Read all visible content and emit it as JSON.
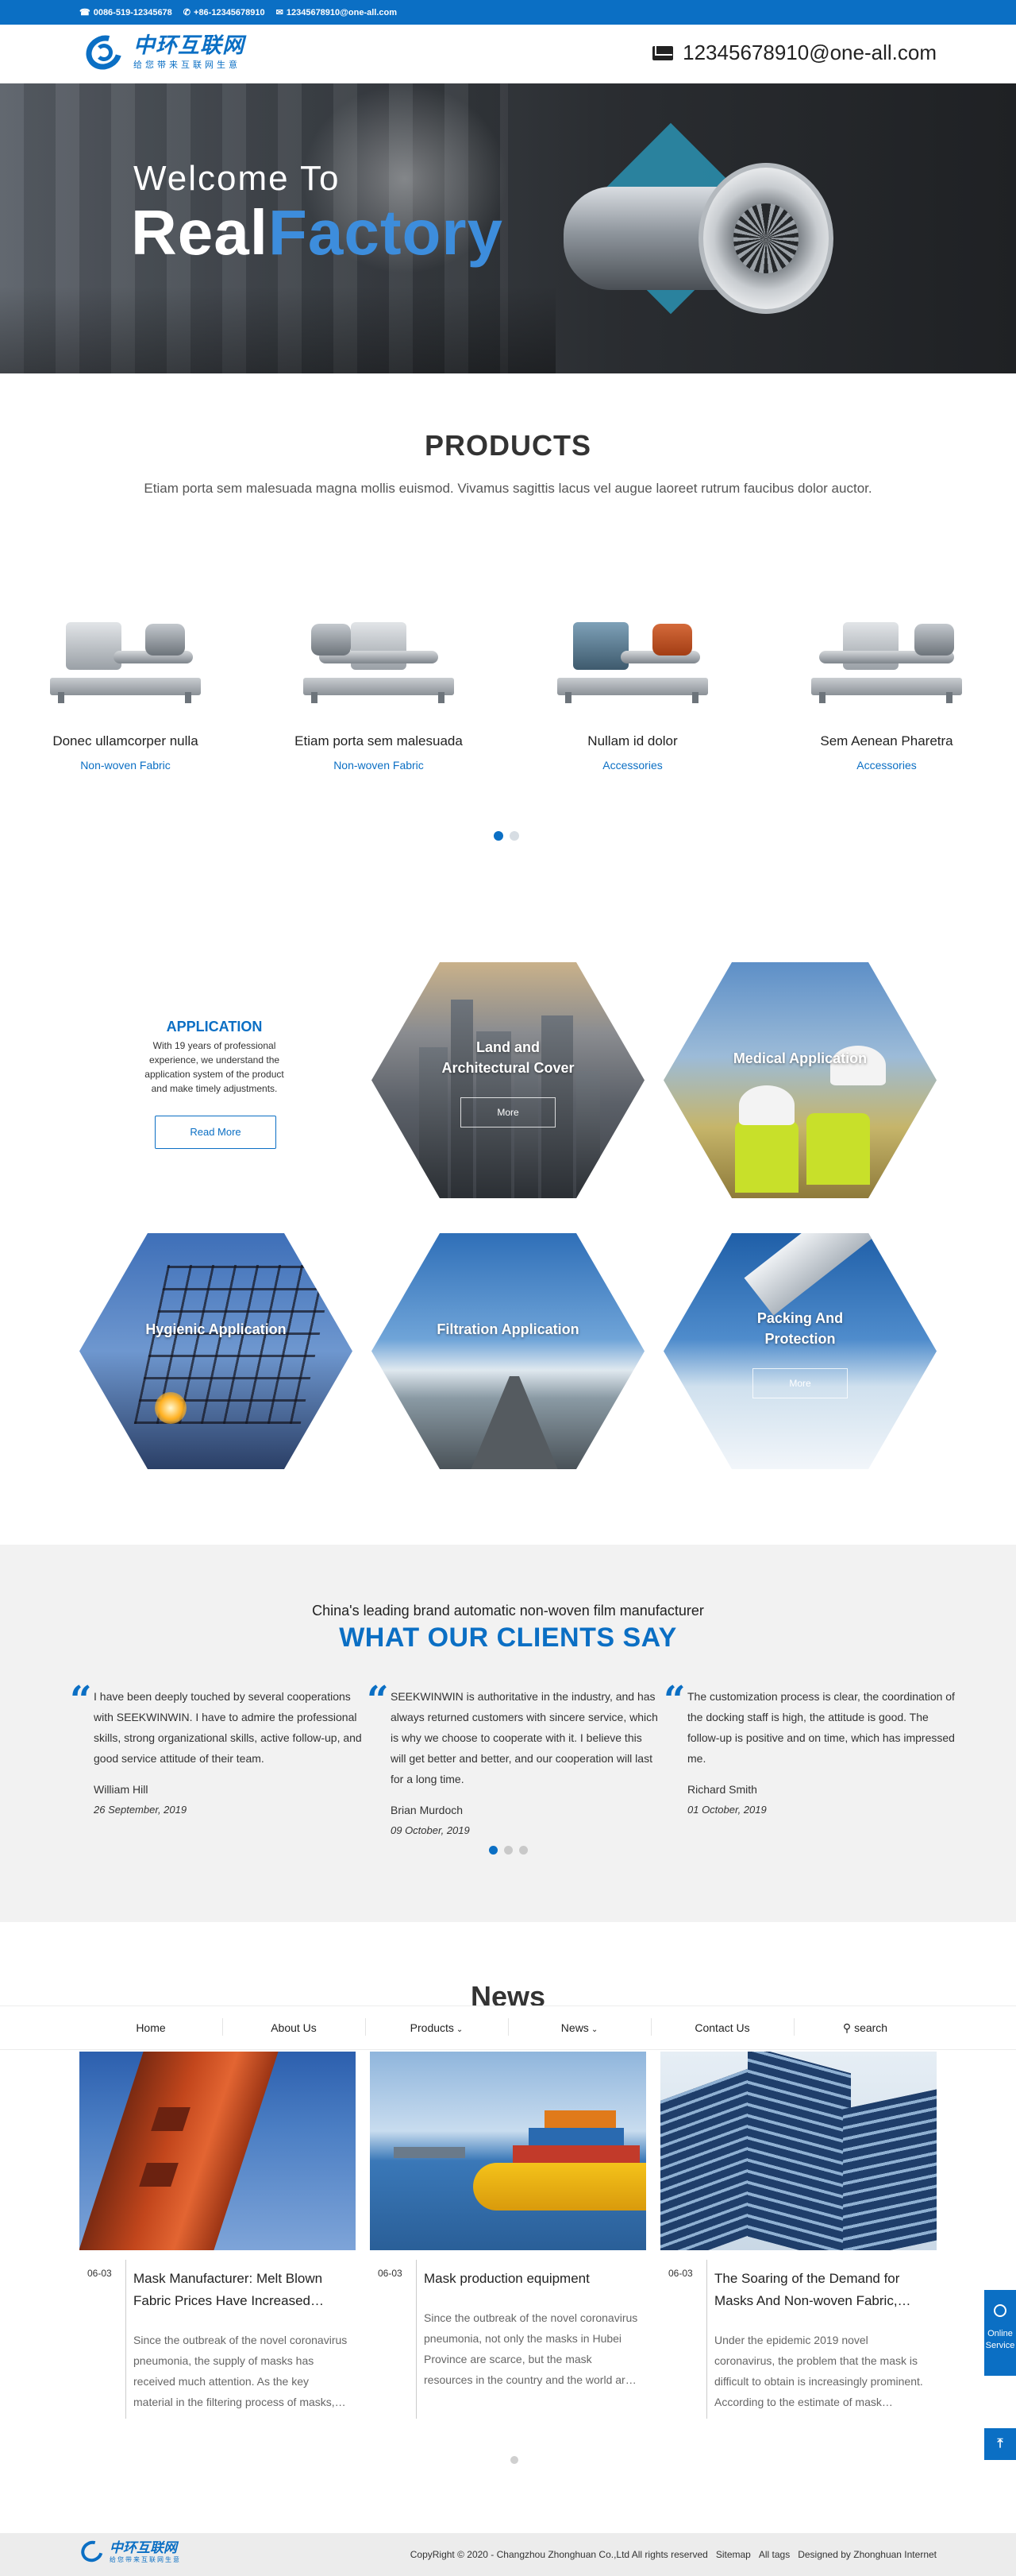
{
  "topbar": {
    "phone": "0086-519-12345678",
    "whatsapp": "+86-12345678910",
    "email": "12345678910@one-all.com"
  },
  "header": {
    "logo_cn": "中环互联网",
    "logo_sub": "给您带来互联网生意",
    "email": "12345678910@one-all.com"
  },
  "banner": {
    "welcome": "Welcome To",
    "real": "Real",
    "factory": "Factory"
  },
  "products": {
    "title": "PRODUCTS",
    "desc": "Etiam porta sem malesuada magna mollis euismod. Vivamus sagittis lacus vel augue laoreet rutrum faucibus dolor auctor.",
    "items": [
      {
        "name": "Donec ullamcorper nulla",
        "category": "Non-woven Fabric"
      },
      {
        "name": "Etiam porta sem malesuada",
        "category": "Non-woven Fabric"
      },
      {
        "name": "Nullam id dolor",
        "category": "Accessories"
      },
      {
        "name": "Sem Aenean Pharetra",
        "category": "Accessories"
      }
    ]
  },
  "application": {
    "title": "APPLICATION",
    "text": "With 19 years of professional experience, we understand the application system of the product and make timely adjustments.",
    "button": "Read More",
    "items": [
      {
        "label_1": "Land and",
        "label_2": "Architectural Cover",
        "more": "More"
      },
      {
        "label_1": "Medical Application",
        "more": ""
      },
      {
        "label_1": "Hygienic Application",
        "more": ""
      },
      {
        "label_1": "Filtration Application",
        "more": ""
      },
      {
        "label_1": "Packing And",
        "label_2": "Protection",
        "more": "More"
      }
    ]
  },
  "testimonials": {
    "subtitle": "China's leading brand automatic non-woven film manufacturer",
    "title": "WHAT OUR CLIENTS SAY",
    "items": [
      {
        "text": "I have been deeply touched by several cooperations with SEEKWINWIN. I have to admire the professional skills, strong organizational skills, active follow-up, and good service attitude of their team.",
        "name": "William Hill",
        "date": "26 September, 2019"
      },
      {
        "text": "SEEKWINWIN is authoritative in the industry, and has always returned customers with sincere service, which is why we choose to cooperate with it. I believe this will get better and better, and our cooperation will last for a long time.",
        "name": "Brian Murdoch",
        "date": "09 October, 2019"
      },
      {
        "text": "The customization process is clear, the coordination of the docking staff is high, the attitude is good. The follow-up is positive and on time, which has impressed me.",
        "name": "Richard Smith",
        "date": "01 October, 2019"
      }
    ]
  },
  "nav": {
    "home": "Home",
    "about": "About Us",
    "products": "Products",
    "news": "News",
    "contact": "Contact Us",
    "search": "search"
  },
  "news": {
    "title": "News",
    "items": [
      {
        "date": "06-03",
        "title": "Mask Manufacturer: Melt Blown Fabric Prices Have Increased…",
        "excerpt": "Since the outbreak of the novel coronavirus pneumonia, the supply of masks has received much attention. As the key material in the filtering process of masks,…"
      },
      {
        "date": "06-03",
        "title": "Mask production equipment",
        "excerpt": "Since the outbreak of the novel coronavirus pneumonia, not only the masks in Hubei Province are scarce, but the mask resources in the country and the world ar…"
      },
      {
        "date": "06-03",
        "title": "The Soaring of the Demand for Masks And Non-woven Fabric,…",
        "excerpt": "Under the epidemic 2019 novel coronavirus, the problem that the mask is difficult to obtain is increasingly prominent. According to the estimate of mask…"
      }
    ]
  },
  "float": {
    "service_1": "Online",
    "service_2": "Service"
  },
  "footer": {
    "logo_cn": "中环互联网",
    "logo_sub": "给您带来互联网生意",
    "copyright": "CopyRight © 2020 - Changzhou Zhonghuan Co.,Ltd  All rights reserved",
    "sitemap": "Sitemap",
    "alltags": "All tags",
    "designed": "Designed by Zhonghuan Internet"
  },
  "colors": {
    "brand": "#0b6fc4"
  }
}
